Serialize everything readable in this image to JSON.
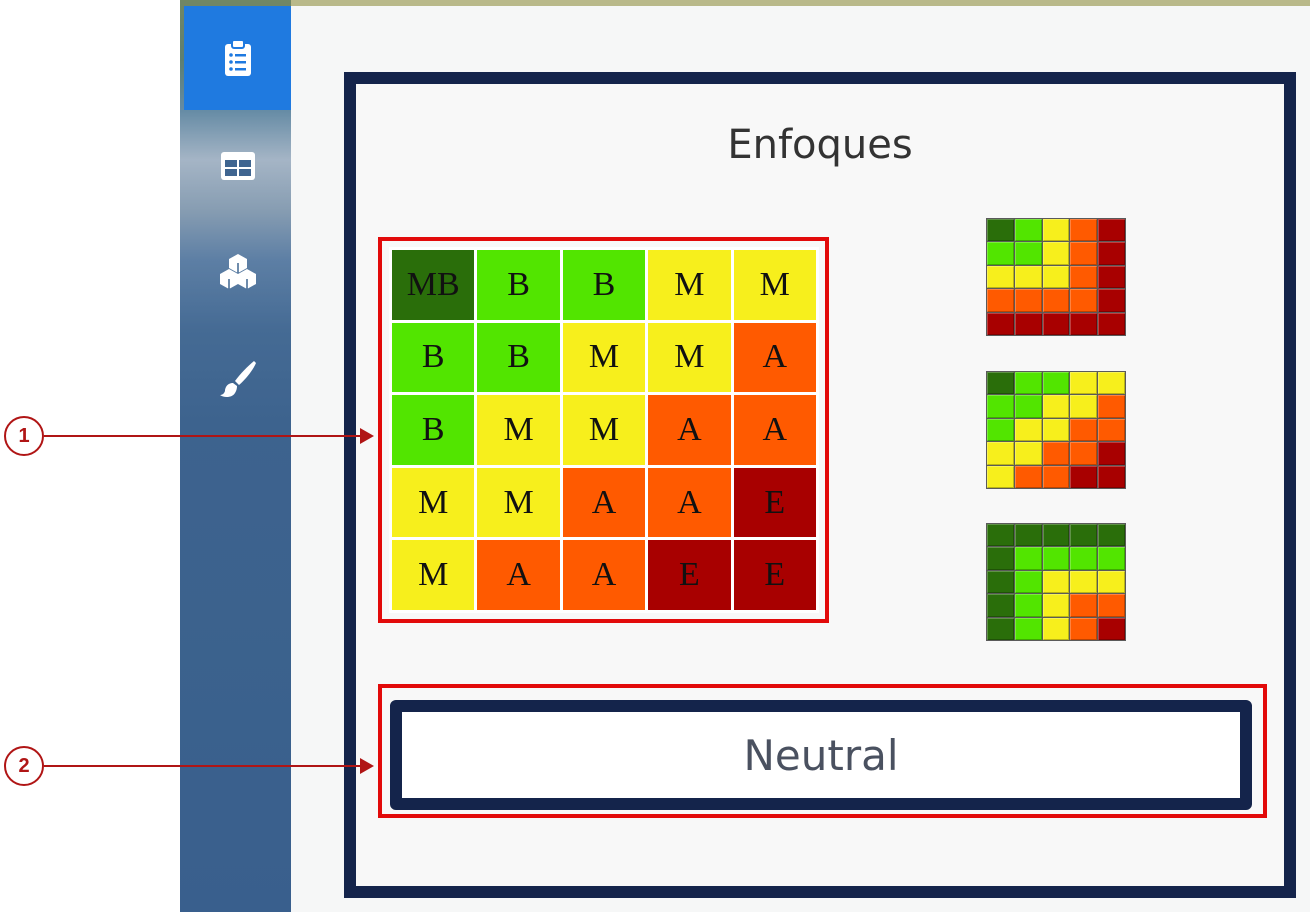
{
  "panel": {
    "title": "Enfoques"
  },
  "sidebar": {
    "items": [
      {
        "icon": "clipboard-list-icon",
        "active": true
      },
      {
        "icon": "table-grid-icon",
        "active": false
      },
      {
        "icon": "cubes-icon",
        "active": false
      },
      {
        "icon": "paintbrush-icon",
        "active": false
      }
    ]
  },
  "matrix": {
    "rows": [
      [
        "MB",
        "B",
        "B",
        "M",
        "M"
      ],
      [
        "B",
        "B",
        "M",
        "M",
        "A"
      ],
      [
        "B",
        "M",
        "M",
        "A",
        "A"
      ],
      [
        "M",
        "M",
        "A",
        "A",
        "E"
      ],
      [
        "M",
        "A",
        "A",
        "E",
        "E"
      ]
    ]
  },
  "thumbnails": [
    {
      "rows": [
        [
          "dg",
          "g",
          "y",
          "o",
          "r"
        ],
        [
          "g",
          "g",
          "y",
          "o",
          "r"
        ],
        [
          "y",
          "y",
          "y",
          "o",
          "r"
        ],
        [
          "o",
          "o",
          "o",
          "o",
          "r"
        ],
        [
          "r",
          "r",
          "r",
          "r",
          "r"
        ]
      ]
    },
    {
      "rows": [
        [
          "dg",
          "g",
          "g",
          "y",
          "y"
        ],
        [
          "g",
          "g",
          "y",
          "y",
          "o"
        ],
        [
          "g",
          "y",
          "y",
          "o",
          "o"
        ],
        [
          "y",
          "y",
          "o",
          "o",
          "r"
        ],
        [
          "y",
          "o",
          "o",
          "r",
          "r"
        ]
      ]
    },
    {
      "rows": [
        [
          "dg",
          "dg",
          "dg",
          "dg",
          "dg"
        ],
        [
          "dg",
          "g",
          "g",
          "g",
          "g"
        ],
        [
          "dg",
          "g",
          "y",
          "y",
          "y"
        ],
        [
          "dg",
          "g",
          "y",
          "o",
          "o"
        ],
        [
          "dg",
          "g",
          "y",
          "o",
          "r"
        ]
      ]
    }
  ],
  "colors": {
    "dg": "#2a6e0a",
    "g": "#52e500",
    "y": "#f7ef1c",
    "o": "#ff5a00",
    "r": "#a80000",
    "accent": "#1f7ae0",
    "frame": "#14244b",
    "annotation": "#e20a0a"
  },
  "level_colors": {
    "MB": "dg",
    "B": "g",
    "M": "y",
    "A": "o",
    "E": "r"
  },
  "neutral_button": {
    "label": "Neutral"
  },
  "annotations": {
    "callout_1": "1",
    "callout_2": "2"
  }
}
